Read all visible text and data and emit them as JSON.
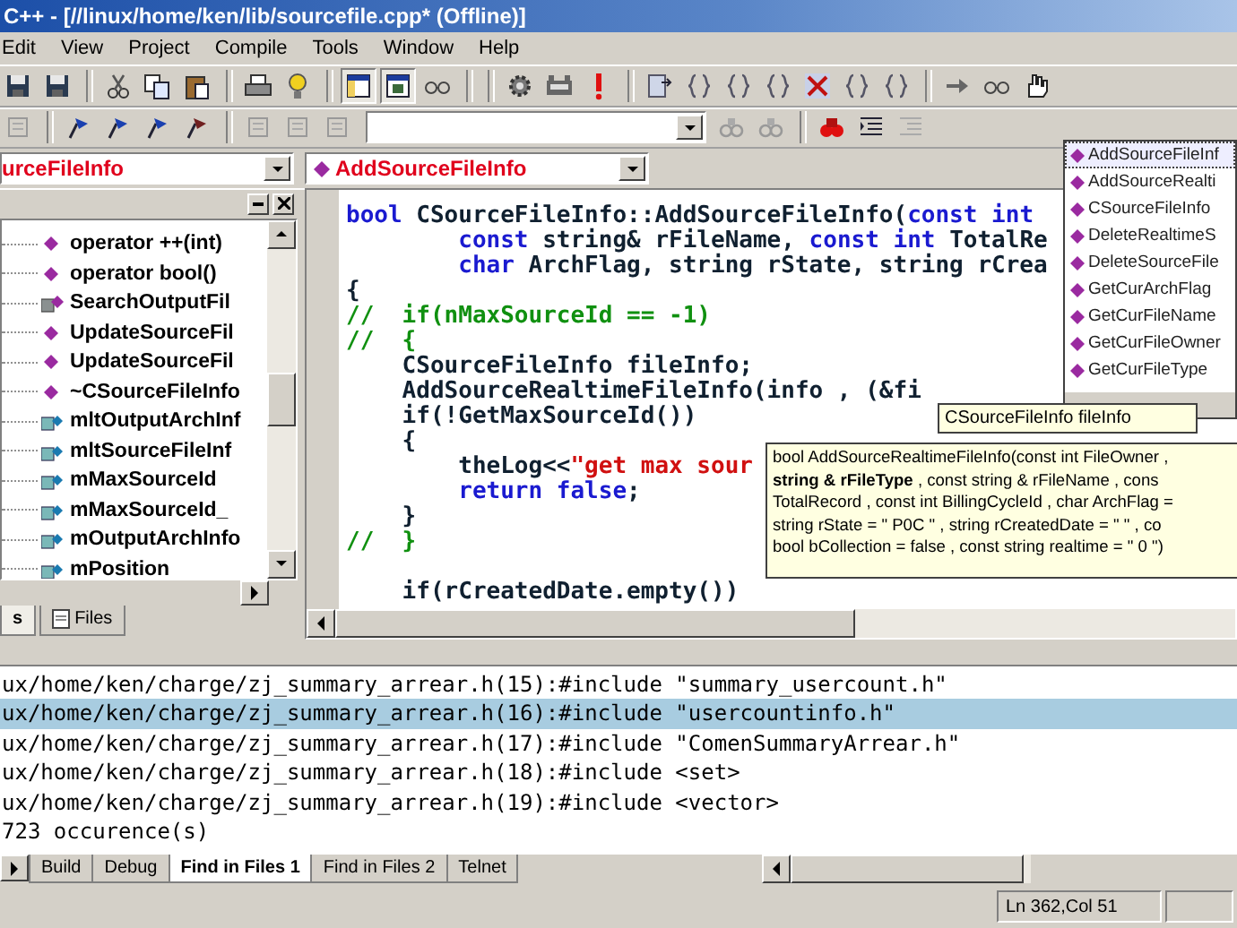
{
  "window": {
    "title": "C++ - [//linux/home/ken/lib/sourcefile.cpp* (Offline)]"
  },
  "menu": [
    "Edit",
    "View",
    "Project",
    "Compile",
    "Tools",
    "Window",
    "Help"
  ],
  "context_bar": {
    "class_combo": {
      "value": "urceFileInfo"
    },
    "member_combo": {
      "value": "AddSourceFileInfo"
    }
  },
  "class_view": {
    "items": [
      {
        "kind": "method",
        "label": "operator ++(int)"
      },
      {
        "kind": "method",
        "label": "operator bool()"
      },
      {
        "kind": "protected_method",
        "label": "SearchOutputFil"
      },
      {
        "kind": "method",
        "label": "UpdateSourceFil"
      },
      {
        "kind": "method",
        "label": "UpdateSourceFil"
      },
      {
        "kind": "method",
        "label": "~CSourceFileInfo"
      },
      {
        "kind": "member",
        "label": "mltOutputArchInf"
      },
      {
        "kind": "member",
        "label": "mltSourceFileInf"
      },
      {
        "kind": "member",
        "label": "mMaxSourceId"
      },
      {
        "kind": "member",
        "label": "mMaxSourceId_"
      },
      {
        "kind": "member",
        "label": "mOutputArchInfo"
      },
      {
        "kind": "member",
        "label": "mPosition"
      }
    ],
    "tabs": [
      {
        "label": "s",
        "selected": true
      },
      {
        "label": "Files",
        "selected": false
      }
    ]
  },
  "editor": {
    "lines": [
      {
        "segments": [
          {
            "kind": "keyword",
            "text": "bool"
          },
          {
            "kind": "plain",
            "text": " CSourceFileInfo::AddSourceFileInfo("
          },
          {
            "kind": "keyword",
            "text": "const int"
          }
        ]
      },
      {
        "segments": [
          {
            "kind": "keyword",
            "text": "        const"
          },
          {
            "kind": "plain",
            "text": " string& rFileName, "
          },
          {
            "kind": "keyword",
            "text": "const int"
          },
          {
            "kind": "plain",
            "text": " TotalRe"
          }
        ]
      },
      {
        "segments": [
          {
            "kind": "keyword",
            "text": "        char"
          },
          {
            "kind": "plain",
            "text": " ArchFlag, string rState, string rCrea"
          }
        ]
      },
      {
        "segments": [
          {
            "kind": "plain",
            "text": "{"
          }
        ]
      },
      {
        "segments": [
          {
            "kind": "comment",
            "text": "//  if(nMaxSourceId == -1)"
          }
        ]
      },
      {
        "segments": [
          {
            "kind": "comment",
            "text": "//  {"
          }
        ]
      },
      {
        "segments": [
          {
            "kind": "plain",
            "text": "    CSourceFileInfo fileInfo;"
          }
        ]
      },
      {
        "segments": [
          {
            "kind": "plain",
            "text": "    AddSourceRealtimeFileInfo(info , (&fi"
          }
        ]
      },
      {
        "segments": [
          {
            "kind": "plain",
            "text": "    if(!GetMaxSourceId())"
          }
        ]
      },
      {
        "segments": [
          {
            "kind": "plain",
            "text": "    {"
          }
        ]
      },
      {
        "segments": [
          {
            "kind": "plain",
            "text": "        theLog<<"
          },
          {
            "kind": "string",
            "text": "\"get max sour"
          }
        ]
      },
      {
        "segments": [
          {
            "kind": "keyword",
            "text": "        return false"
          },
          {
            "kind": "plain",
            "text": ";"
          }
        ]
      },
      {
        "segments": [
          {
            "kind": "plain",
            "text": "    }"
          }
        ]
      },
      {
        "segments": [
          {
            "kind": "comment",
            "text": "//  }"
          }
        ]
      },
      {
        "gap_before": true,
        "segments": [
          {
            "kind": "plain",
            "text": "    if(rCreatedDate.empty())"
          }
        ]
      }
    ]
  },
  "completion_list": {
    "items": [
      {
        "label": "AddSourceFileInf",
        "selected": true
      },
      {
        "label": "AddSourceRealti",
        "selected": false
      },
      {
        "label": "CSourceFileInfo",
        "selected": false
      },
      {
        "label": "DeleteRealtimeS",
        "selected": false
      },
      {
        "label": "DeleteSourceFile",
        "selected": false
      },
      {
        "label": "GetCurArchFlag",
        "selected": false
      },
      {
        "label": "GetCurFileName",
        "selected": false
      },
      {
        "label": "GetCurFileOwner",
        "selected": false
      },
      {
        "label": "GetCurFileType",
        "selected": false
      }
    ]
  },
  "member_tooltip": "CSourceFileInfo fileInfo",
  "signature_tooltip": {
    "lines": [
      "bool AddSourceRealtimeFileInfo(const int FileOwner ,",
      "**string & rFileType** , const string & rFileName , cons",
      "TotalRecord , const int BillingCycleId , char ArchFlag =",
      "string rState = \" P0C \" , string rCreatedDate = \" \" , co",
      "bool bCollection = false , const string realtime = \" 0 \")"
    ]
  },
  "output": {
    "lines": [
      {
        "text": "ux/home/ken/charge/zj_summary_arrear.h(15):#include \"summary_usercount.h\"",
        "selected": false
      },
      {
        "text": "ux/home/ken/charge/zj_summary_arrear.h(16):#include \"usercountinfo.h\"",
        "selected": true
      },
      {
        "text": "ux/home/ken/charge/zj_summary_arrear.h(17):#include \"ComenSummaryArrear.h\"",
        "selected": false
      },
      {
        "text": "ux/home/ken/charge/zj_summary_arrear.h(18):#include <set>",
        "selected": false
      },
      {
        "text": "ux/home/ken/charge/zj_summary_arrear.h(19):#include <vector>",
        "selected": false
      },
      {
        "text": "723 occurence(s)",
        "selected": false
      }
    ],
    "tabs": [
      {
        "label": "Build",
        "selected": false
      },
      {
        "label": "Debug",
        "selected": false
      },
      {
        "label": "Find in Files 1",
        "selected": true
      },
      {
        "label": "Find in Files 2",
        "selected": false
      },
      {
        "label": "Telnet",
        "selected": false
      }
    ]
  },
  "status_bar": {
    "position": "Ln 362,Col 51"
  }
}
